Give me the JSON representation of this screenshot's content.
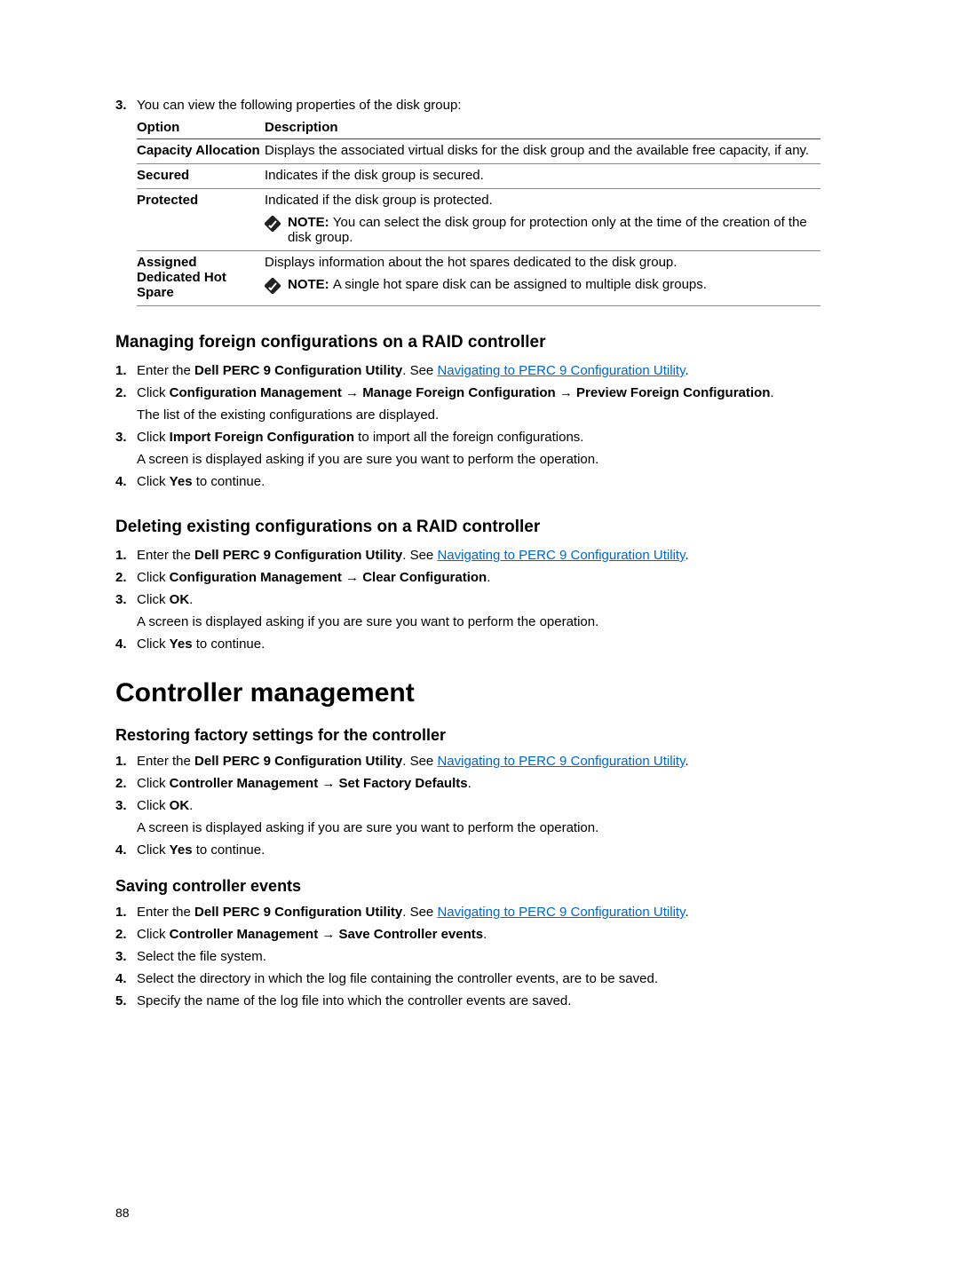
{
  "intro": {
    "step3_num": "3.",
    "step3_text": "You can view the following properties of the disk group:"
  },
  "table": {
    "header_option": "Option",
    "header_desc": "Description",
    "rows": [
      {
        "option": "Capacity Allocation",
        "desc": "Displays the associated virtual disks for the disk group and the available free capacity, if any."
      },
      {
        "option": "Secured",
        "desc": "Indicates if the disk group is secured."
      },
      {
        "option": "Protected",
        "desc": "Indicated if the disk group is protected.",
        "note_prefix": "NOTE: ",
        "note": "You can select the disk group for protection only at the time of the creation of the disk group."
      },
      {
        "option": "Assigned Dedicated Hot Spare",
        "desc": "Displays information about the hot spares dedicated to the disk group.",
        "note_prefix": "NOTE: ",
        "note": "A single hot spare disk can be assigned to multiple disk groups."
      }
    ]
  },
  "section_managing": {
    "title": "Managing foreign configurations on a RAID controller",
    "steps": [
      {
        "num": "1.",
        "pre": "Enter the ",
        "b1": "Dell PERC 9 Configuration Utility",
        "mid": ". See ",
        "link": "Navigating to PERC 9 Configuration Utility",
        "post": "."
      },
      {
        "num": "2.",
        "pre": "Click ",
        "b1": "Configuration Management",
        "arrow1": " → ",
        "b2": "Manage Foreign Configuration",
        "arrow2": " → ",
        "b3": "Preview Foreign Configuration",
        "post": ".",
        "sub": "The list of the existing configurations are displayed."
      },
      {
        "num": "3.",
        "pre": "Click ",
        "b1": "Import Foreign Configuration",
        "post": " to import all the foreign configurations.",
        "sub": "A screen is displayed asking if you are sure you want to perform the operation."
      },
      {
        "num": "4.",
        "pre": "Click ",
        "b1": "Yes",
        "post": " to continue."
      }
    ]
  },
  "section_deleting": {
    "title": "Deleting existing configurations on a RAID controller",
    "steps": [
      {
        "num": "1.",
        "pre": "Enter the ",
        "b1": "Dell PERC 9 Configuration Utility",
        "mid": ". See ",
        "link": "Navigating to PERC 9 Configuration Utility",
        "post": "."
      },
      {
        "num": "2.",
        "pre": "Click ",
        "b1": "Configuration Management",
        "arrow1": " → ",
        "b2": "Clear Configuration",
        "post": "."
      },
      {
        "num": "3.",
        "pre": "Click ",
        "b1": "OK",
        "post": ".",
        "sub": "A screen is displayed asking if you are sure you want to perform the operation."
      },
      {
        "num": "4.",
        "pre": "Click ",
        "b1": "Yes",
        "post": " to continue."
      }
    ]
  },
  "section_controller": {
    "heading": "Controller management"
  },
  "section_restoring": {
    "title": "Restoring factory settings for the controller",
    "steps": [
      {
        "num": "1.",
        "pre": "Enter the ",
        "b1": "Dell PERC 9 Configuration Utility",
        "mid": ". See ",
        "link": "Navigating to PERC 9 Configuration Utility",
        "post": "."
      },
      {
        "num": "2.",
        "pre": "Click ",
        "b1": "Controller Management",
        "arrow1": " → ",
        "b2": "Set Factory Defaults",
        "post": "."
      },
      {
        "num": "3.",
        "pre": "Click ",
        "b1": "OK",
        "post": ".",
        "sub": "A screen is displayed asking if you are sure you want to perform the operation."
      },
      {
        "num": "4.",
        "pre": "Click ",
        "b1": "Yes",
        "post": " to continue."
      }
    ]
  },
  "section_saving": {
    "title": "Saving controller events",
    "steps": [
      {
        "num": "1.",
        "pre": "Enter the ",
        "b1": "Dell PERC 9 Configuration Utility",
        "mid": ". See ",
        "link": "Navigating to PERC 9 Configuration Utility",
        "post": "."
      },
      {
        "num": "2.",
        "pre": "Click ",
        "b1": "Controller Management",
        "arrow1": " → ",
        "b2": "Save Controller events",
        "post": "."
      },
      {
        "num": "3.",
        "pre": "Select the file system.",
        "post": ""
      },
      {
        "num": "4.",
        "pre": "Select the directory in which the log file containing the controller events, are to be saved.",
        "post": ""
      },
      {
        "num": "5.",
        "pre": "Specify the name of the log file into which the controller events are saved.",
        "post": ""
      }
    ]
  },
  "page_number": "88"
}
